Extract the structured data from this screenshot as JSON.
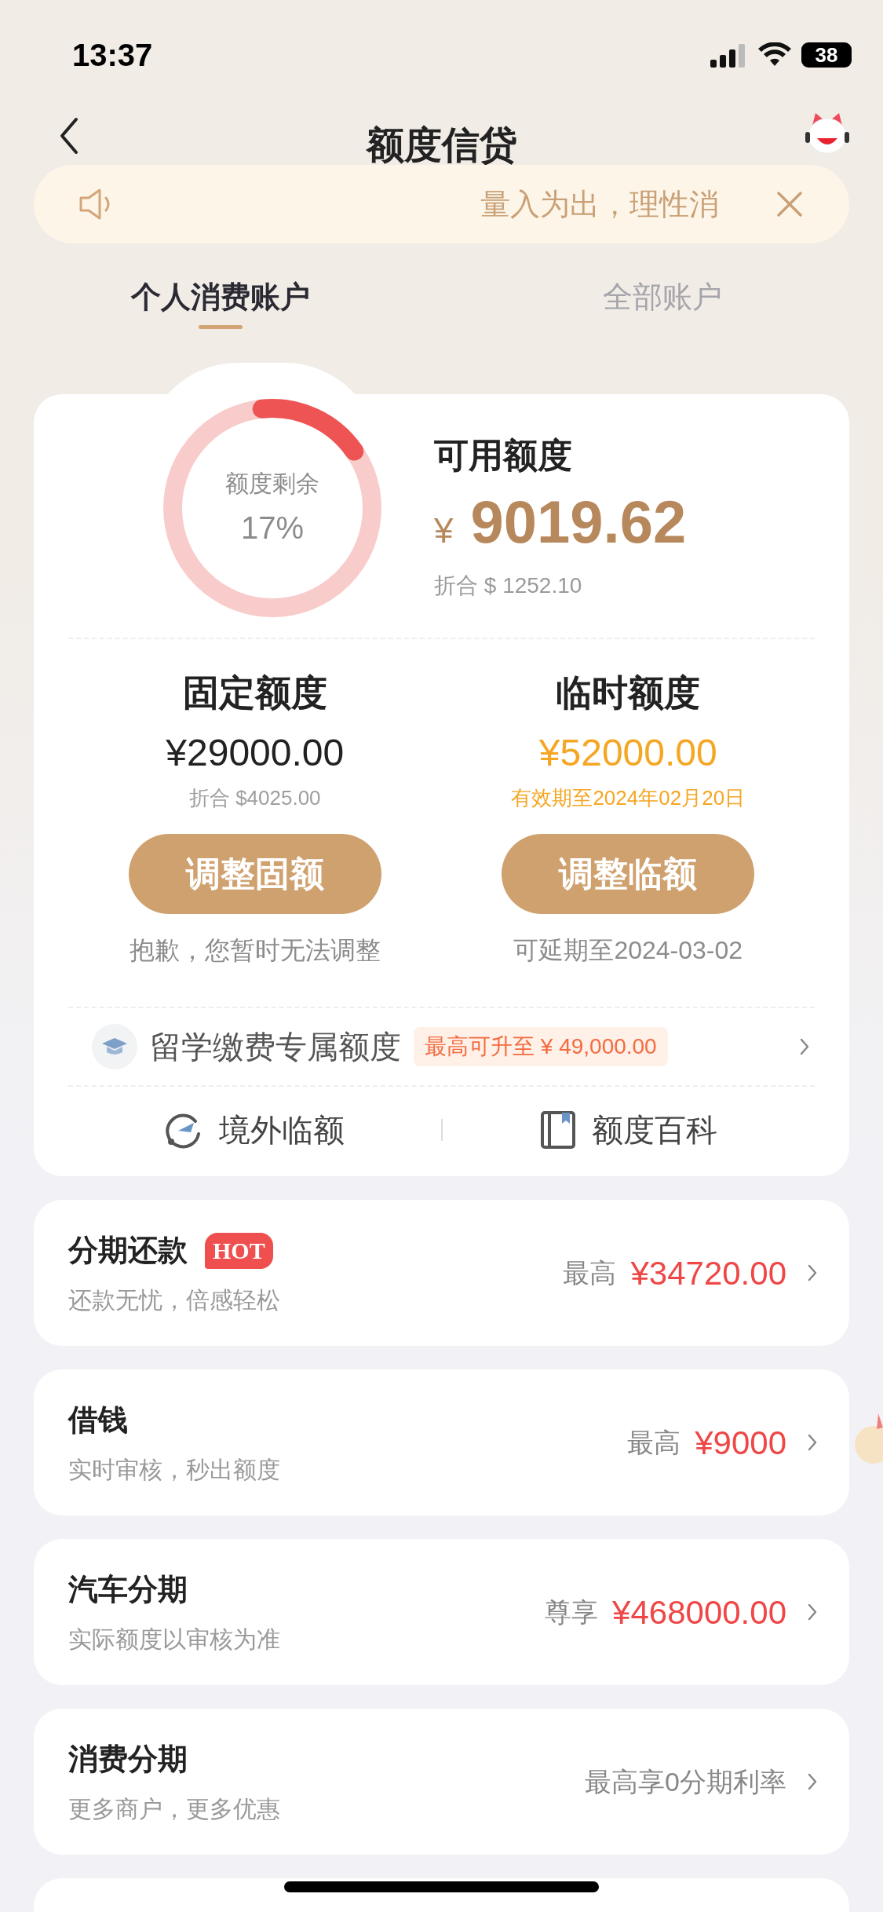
{
  "status_bar": {
    "time": "13:37",
    "battery": "38"
  },
  "header": {
    "title": "额度信贷"
  },
  "notice": {
    "text": "量入为出，理性消"
  },
  "tabs": [
    {
      "label": "个人消费账户",
      "selected": true
    },
    {
      "label": "全部账户",
      "selected": false
    }
  ],
  "summary": {
    "gauge": {
      "label": "额度剩余",
      "percent": "17%"
    },
    "title": "可用额度",
    "currency": "¥",
    "amount": "9019.62",
    "converted": "折合 $ 1252.10"
  },
  "limits": [
    {
      "title": "固定额度",
      "amount": "¥29000.00",
      "note": "折合 $4025.00",
      "highlight": false,
      "button": "调整固额",
      "footer": "抱歉，您暂时无法调整"
    },
    {
      "title": "临时额度",
      "amount": "¥52000.00",
      "note": "有效期至2024年02月20日",
      "highlight": true,
      "button": "调整临额",
      "footer": "可延期至2024-03-02"
    }
  ],
  "study": {
    "label": "留学缴费专属额度",
    "tag": "最高可升至 ¥ 49,000.00"
  },
  "links": [
    {
      "kind": "plane",
      "label": "境外临额"
    },
    {
      "kind": "book",
      "label": "额度百科"
    }
  ],
  "products": [
    {
      "title": "分期还款",
      "badge": "HOT",
      "subtitle": "还款无忧，倍感轻松",
      "kind": "amount",
      "prefix": "最高",
      "value": "¥34720.00"
    },
    {
      "title": "借钱",
      "subtitle": "实时审核，秒出额度",
      "kind": "amount",
      "prefix": "最高",
      "value": "¥9000"
    },
    {
      "title": "汽车分期",
      "subtitle": "实际额度以审核为准",
      "kind": "amount",
      "prefix": "尊享",
      "value": "¥468000.00"
    },
    {
      "title": "消费分期",
      "subtitle": "更多商户，更多优惠",
      "kind": "text",
      "value": "最高享0分期利率"
    }
  ]
}
